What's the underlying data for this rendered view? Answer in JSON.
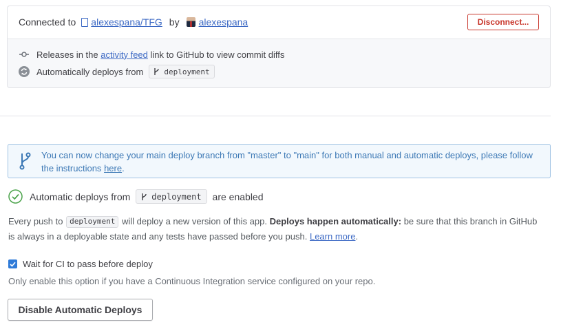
{
  "connection": {
    "prefix": "Connected to",
    "repo": "alexespana/TFG",
    "by": "by",
    "user": "alexespana",
    "disconnect_label": "Disconnect..."
  },
  "releases": {
    "text_before": "Releases in the",
    "link": "activity feed",
    "text_after": "link to GitHub to view commit diffs"
  },
  "auto_deploy_info": {
    "text": "Automatically deploys from",
    "branch": "deployment"
  },
  "notice": {
    "text": "You can now change your main deploy branch from \"master\" to \"main\" for both manual and automatic deploys, please follow the instructions",
    "link": "here",
    "end": ".",
    "color": "#3c78b5"
  },
  "auto_status": {
    "before": "Automatic deploys from",
    "branch": "deployment",
    "after": "are enabled",
    "status_color": "#4ba34b"
  },
  "description": {
    "part1": "Every push to",
    "branch": "deployment",
    "part2": "will deploy a new version of this app.",
    "bold": "Deploys happen automatically:",
    "part3": "be sure that this branch in GitHub is always in a deployable state and any tests have passed before you push.",
    "link": "Learn more",
    "end": "."
  },
  "wait_ci": {
    "label": "Wait for CI to pass before deploy",
    "checked": true,
    "help": "Only enable this option if you have a Continuous Integration service configured on your repo."
  },
  "disable_button": {
    "label": "Disable Automatic Deploys"
  }
}
